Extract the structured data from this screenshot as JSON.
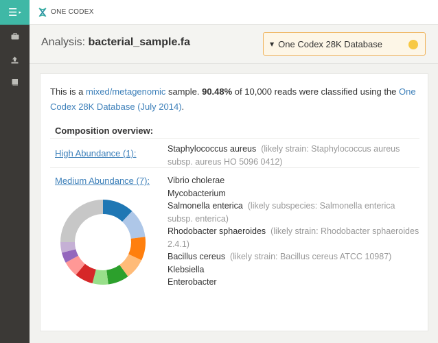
{
  "brand": {
    "name": "ONE CODEX"
  },
  "sidebar": {
    "menu_icon": "hamburger-icon",
    "items": [
      {
        "icon": "briefcase-icon"
      },
      {
        "icon": "upload-icon"
      },
      {
        "icon": "book-icon"
      }
    ]
  },
  "analysis": {
    "prefix": "Analysis:",
    "filename": "bacterial_sample.fa"
  },
  "database_select": {
    "selected": "One Codex 28K Database",
    "status_color": "#f7c945"
  },
  "summary": {
    "t1": "This is a ",
    "sample_type": "mixed/metagenomic",
    "t2": " sample. ",
    "percent": "90.48%",
    "t3": " of 10,000 reads were classified using the ",
    "db_link": "One Codex 28K Database",
    "t4": " ",
    "db_version": "(July 2014)",
    "t5": "."
  },
  "composition": {
    "title": "Composition overview:",
    "high": {
      "label": "High Abundance (1):",
      "organisms": [
        {
          "name": "Staphylococcus aureus",
          "note": "(likely strain: Staphylococcus aureus subsp. aureus HO 5096 0412)"
        }
      ]
    },
    "medium": {
      "label": "Medium Abundance (7):",
      "organisms": [
        {
          "name": "Vibrio cholerae",
          "note": ""
        },
        {
          "name": "Mycobacterium",
          "note": ""
        },
        {
          "name": "Salmonella enterica",
          "note": "(likely subspecies: Salmonella enterica subsp. enterica)"
        },
        {
          "name": "Rhodobacter sphaeroides",
          "note": "(likely strain: Rhodobacter sphaeroides 2.4.1)"
        },
        {
          "name": "Bacillus cereus",
          "note": "(likely strain: Bacillus cereus ATCC 10987)"
        },
        {
          "name": "Klebsiella",
          "note": ""
        },
        {
          "name": "Enterobacter",
          "note": ""
        }
      ]
    },
    "donut_slices": [
      {
        "value": 12,
        "color": "#1f77b4"
      },
      {
        "value": 11,
        "color": "#aec7e8"
      },
      {
        "value": 9,
        "color": "#ff7f0e"
      },
      {
        "value": 8,
        "color": "#ffbb78"
      },
      {
        "value": 8,
        "color": "#2ca02c"
      },
      {
        "value": 6,
        "color": "#98df8a"
      },
      {
        "value": 7,
        "color": "#d62728"
      },
      {
        "value": 6,
        "color": "#ff9896"
      },
      {
        "value": 4,
        "color": "#9467bd"
      },
      {
        "value": 4,
        "color": "#c5b0d5"
      },
      {
        "value": 25,
        "color": "#c7c7c7"
      }
    ]
  }
}
